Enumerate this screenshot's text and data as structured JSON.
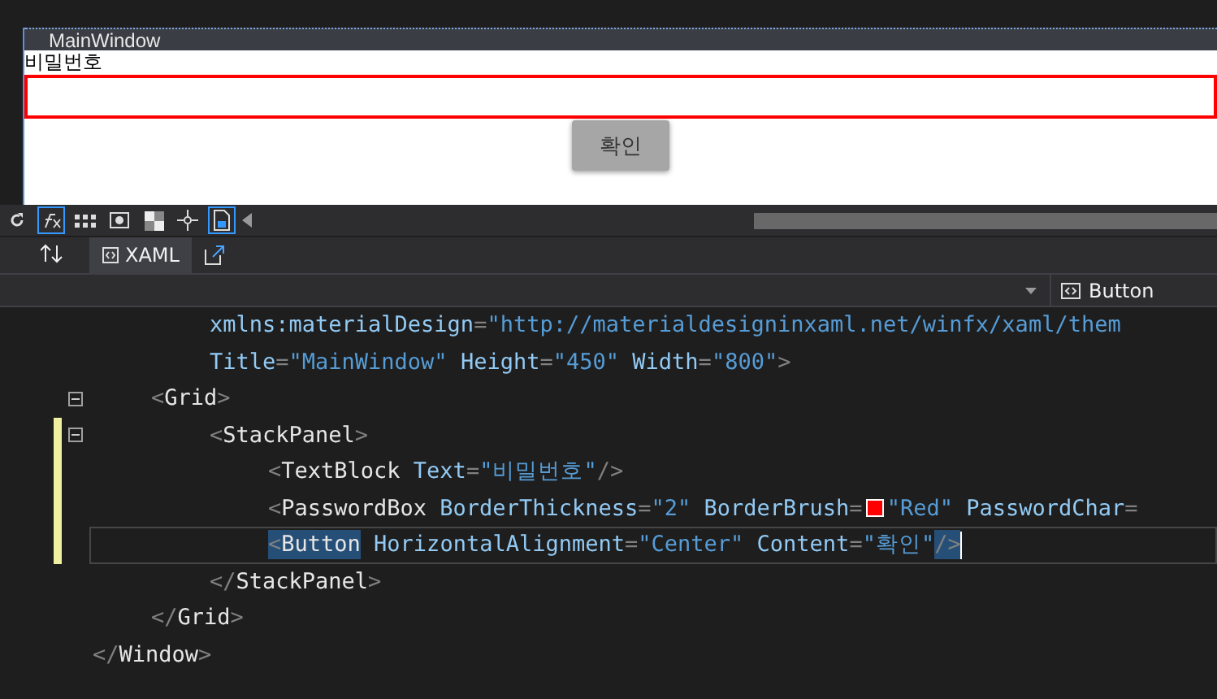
{
  "designer": {
    "window_title": "MainWindow",
    "label": "비밀번호",
    "button": "확인"
  },
  "tabs": [
    {
      "label": "XAML",
      "selected": true
    }
  ],
  "element_selector": {
    "value": "Button"
  },
  "code": {
    "attribute_lines": [
      {
        "tokens": [
          {
            "kind": "attr",
            "text": "xmlns:materialDesign"
          },
          {
            "kind": "punct",
            "text": "="
          },
          {
            "kind": "value",
            "text": "\"http://materialdesigninxaml.net/winfx/xaml/them"
          }
        ]
      },
      {
        "tokens": [
          {
            "kind": "attr",
            "text": "Title"
          },
          {
            "kind": "punct",
            "text": "="
          },
          {
            "kind": "value",
            "text": "\"MainWindow\""
          },
          {
            "kind": "attr",
            "text": " Height"
          },
          {
            "kind": "punct",
            "text": "="
          },
          {
            "kind": "value",
            "text": "\"450\""
          },
          {
            "kind": "attr",
            "text": " Width"
          },
          {
            "kind": "punct",
            "text": "="
          },
          {
            "kind": "value",
            "text": "\"800\""
          },
          {
            "kind": "punct",
            "text": ">"
          }
        ]
      }
    ],
    "children": [
      {
        "changed": false,
        "current": false,
        "tokens": [
          {
            "kind": "punct",
            "text": "<"
          },
          {
            "kind": "element",
            "text": "Grid"
          },
          {
            "kind": "punct",
            "text": ">"
          }
        ],
        "children": [
          {
            "changed": true,
            "current": false,
            "tokens": [
              {
                "kind": "punct",
                "text": "<"
              },
              {
                "kind": "element",
                "text": "StackPanel"
              },
              {
                "kind": "punct",
                "text": ">"
              }
            ],
            "children": [
              {
                "changed": true,
                "current": false,
                "tokens": [
                  {
                    "kind": "punct",
                    "text": "<"
                  },
                  {
                    "kind": "element",
                    "text": "TextBlock"
                  },
                  {
                    "kind": "attr",
                    "text": " Text"
                  },
                  {
                    "kind": "punct",
                    "text": "="
                  },
                  {
                    "kind": "value",
                    "text": "\"비밀번호\""
                  },
                  {
                    "kind": "punct",
                    "text": "/>"
                  }
                ]
              },
              {
                "changed": true,
                "current": false,
                "tokens": [
                  {
                    "kind": "punct",
                    "text": "<"
                  },
                  {
                    "kind": "element",
                    "text": "PasswordBox"
                  },
                  {
                    "kind": "attr",
                    "text": " BorderThickness"
                  },
                  {
                    "kind": "punct",
                    "text": "="
                  },
                  {
                    "kind": "value",
                    "text": "\"2\""
                  },
                  {
                    "kind": "attr",
                    "text": " BorderBrush"
                  },
                  {
                    "kind": "punct",
                    "text": "="
                  },
                  {
                    "kind": "swatch",
                    "color": "#ff0000"
                  },
                  {
                    "kind": "value",
                    "text": "\"Red\""
                  },
                  {
                    "kind": "attr",
                    "text": " PasswordChar"
                  },
                  {
                    "kind": "punct",
                    "text": "="
                  }
                ]
              },
              {
                "changed": true,
                "current": true,
                "tokens": [
                  {
                    "kind": "punct",
                    "text": "<",
                    "highlighted": true
                  },
                  {
                    "kind": "element",
                    "text": "Button",
                    "highlighted": true
                  },
                  {
                    "kind": "attr",
                    "text": " HorizontalAlignment"
                  },
                  {
                    "kind": "punct",
                    "text": "="
                  },
                  {
                    "kind": "value",
                    "text": "\"Center\""
                  },
                  {
                    "kind": "attr",
                    "text": " Content"
                  },
                  {
                    "kind": "punct",
                    "text": "="
                  },
                  {
                    "kind": "value",
                    "text": "\"확인\""
                  },
                  {
                    "kind": "punct",
                    "text": "/>",
                    "highlighted": true
                  }
                ]
              }
            ],
            "closing": [
              {
                "kind": "punct",
                "text": "</"
              },
              {
                "kind": "element",
                "text": "StackPanel"
              },
              {
                "kind": "punct",
                "text": ">"
              }
            ]
          }
        ],
        "closing": [
          {
            "kind": "punct",
            "text": "</"
          },
          {
            "kind": "element",
            "text": "Grid"
          },
          {
            "kind": "punct",
            "text": ">"
          }
        ]
      }
    ],
    "closing": [
      {
        "kind": "punct",
        "text": "</"
      },
      {
        "kind": "element",
        "text": "Window"
      },
      {
        "kind": "punct",
        "text": ">"
      }
    ]
  }
}
